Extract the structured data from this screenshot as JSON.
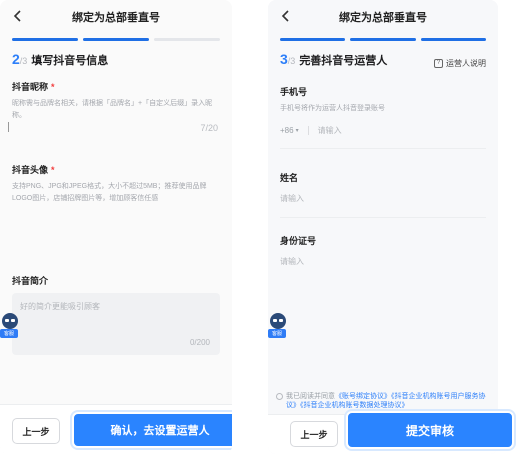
{
  "left": {
    "nav_title": "绑定为总部垂直号",
    "step_current": "2",
    "step_total": "/3",
    "step_title": "填写抖音号信息",
    "nickname": {
      "label": "抖音昵称",
      "required_mark": "*",
      "desc": "昵称需与品牌名相关，请根据「品牌名」+「自定义后缀」录入昵称。",
      "counter": "7/20"
    },
    "avatar": {
      "label": "抖音头像",
      "required_mark": "*",
      "desc": "支持PNG、JPG和JPEG格式，大小不超过5MB；推荐使用品牌LOGO图片，店铺招牌图片等，增加顾客信任感"
    },
    "intro": {
      "label": "抖音简介",
      "placeholder": "好的简介更能吸引顾客",
      "counter": "0/200"
    },
    "service_tag": "客服",
    "prev_button": "上一步",
    "next_button": "确认，去设置运营人"
  },
  "right": {
    "nav_title": "绑定为总部垂直号",
    "step_current": "3",
    "step_total": "/3",
    "step_title": "完善抖音号运营人",
    "help_link": "运营人说明",
    "phone": {
      "label": "手机号",
      "desc": "手机号将作为运营人抖音登录账号",
      "country_code": "+86",
      "placeholder": "请输入"
    },
    "name": {
      "label": "姓名",
      "placeholder": "请输入"
    },
    "id_number": {
      "label": "身份证号",
      "placeholder": "请输入"
    },
    "service_tag": "客服",
    "agreement": {
      "prefix": "我已阅读并同意",
      "link1": "《账号绑定协议》",
      "link2": "《抖音企业机构账号用户服务协议》",
      "link3": "《抖音企业机构账号数据处理协议》"
    },
    "prev_button": "上一步",
    "submit_button": "提交审核"
  },
  "colors": {
    "accent": "#2a84ff",
    "progress_active": "#1f6fe5",
    "required": "#f23c3c"
  }
}
